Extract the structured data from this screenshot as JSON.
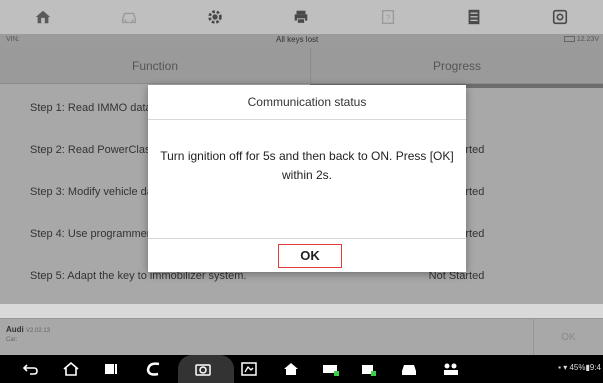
{
  "topbar": {
    "icons": [
      "home-icon",
      "car-icon",
      "gear-icon",
      "printer-icon",
      "help-icon",
      "data-log-icon",
      "screenshot-icon"
    ]
  },
  "vinbar": {
    "vin_label": "VIN:",
    "title": "All keys lost",
    "voltage": "12.23V"
  },
  "table": {
    "headers": {
      "function": "Function",
      "progress": "Progress"
    },
    "rows": [
      {
        "function": "Step 1: Read IMMO data.",
        "progress": ""
      },
      {
        "function": "Step 2: Read PowerClass.",
        "progress": "Not Started"
      },
      {
        "function": "Step 3: Modify vehicle data.",
        "progress": "Not Started"
      },
      {
        "function": "Step 4: Use programmer.",
        "progress": "Not Started"
      },
      {
        "function": "Step 5: Adapt the key to immobilizer system.",
        "progress": "Not Started"
      }
    ]
  },
  "bottombar": {
    "make": "Audi",
    "version": "V2.02.13",
    "car_label": "Car:",
    "ok_label": "OK"
  },
  "dialog": {
    "title": "Communication status",
    "message": "Turn ignition off for 5s and then back to ON. Press [OK] within 2s.",
    "ok_label": "OK"
  },
  "android": {
    "status": "45%",
    "time": "9:4"
  },
  "colors": {
    "dialog_ok_border": "#e03a3a",
    "overlay_dim": "#808080"
  }
}
